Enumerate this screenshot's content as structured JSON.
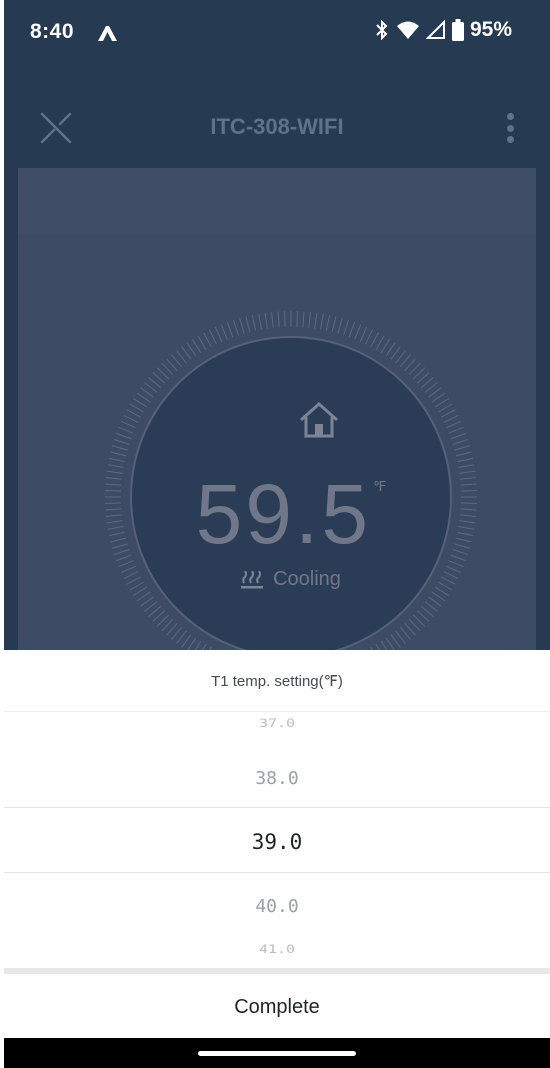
{
  "status_bar": {
    "time": "8:40",
    "battery_text": "95%",
    "icons": [
      "app-logo-icon",
      "bluetooth-icon",
      "wifi-icon",
      "cell-signal-icon",
      "battery-icon"
    ]
  },
  "app_bar": {
    "title": "ITC-308-WIFI",
    "close_icon": "close-icon",
    "menu_icon": "more-vert-icon"
  },
  "thermostat": {
    "temperature": "59.5",
    "unit": "℉",
    "mode_label": "Cooling",
    "mode_icon": "heat-waves-icon",
    "home_icon": "home-icon"
  },
  "picker_sheet": {
    "title": "T1 temp. setting(℉)",
    "options": [
      "37.0",
      "38.0",
      "39.0",
      "40.0",
      "41.0"
    ],
    "selected": "39.0",
    "complete_label": "Complete"
  },
  "colors": {
    "app_background": "#263a52",
    "panel": "#3e4b64",
    "dial_inner": "#2b3c56",
    "sheet_background": "#ffffff"
  }
}
